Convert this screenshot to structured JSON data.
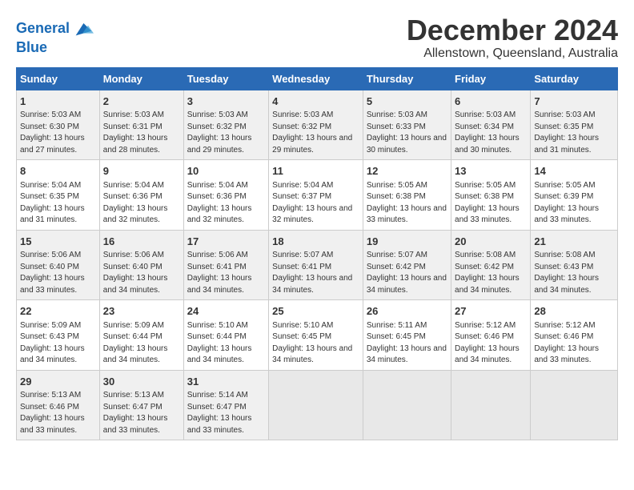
{
  "logo": {
    "line1": "General",
    "line2": "Blue"
  },
  "title": "December 2024",
  "subtitle": "Allenstown, Queensland, Australia",
  "weekdays": [
    "Sunday",
    "Monday",
    "Tuesday",
    "Wednesday",
    "Thursday",
    "Friday",
    "Saturday"
  ],
  "weeks": [
    [
      {
        "day": "1",
        "sunrise": "Sunrise: 5:03 AM",
        "sunset": "Sunset: 6:30 PM",
        "daylight": "Daylight: 13 hours and 27 minutes."
      },
      {
        "day": "2",
        "sunrise": "Sunrise: 5:03 AM",
        "sunset": "Sunset: 6:31 PM",
        "daylight": "Daylight: 13 hours and 28 minutes."
      },
      {
        "day": "3",
        "sunrise": "Sunrise: 5:03 AM",
        "sunset": "Sunset: 6:32 PM",
        "daylight": "Daylight: 13 hours and 29 minutes."
      },
      {
        "day": "4",
        "sunrise": "Sunrise: 5:03 AM",
        "sunset": "Sunset: 6:32 PM",
        "daylight": "Daylight: 13 hours and 29 minutes."
      },
      {
        "day": "5",
        "sunrise": "Sunrise: 5:03 AM",
        "sunset": "Sunset: 6:33 PM",
        "daylight": "Daylight: 13 hours and 30 minutes."
      },
      {
        "day": "6",
        "sunrise": "Sunrise: 5:03 AM",
        "sunset": "Sunset: 6:34 PM",
        "daylight": "Daylight: 13 hours and 30 minutes."
      },
      {
        "day": "7",
        "sunrise": "Sunrise: 5:03 AM",
        "sunset": "Sunset: 6:35 PM",
        "daylight": "Daylight: 13 hours and 31 minutes."
      }
    ],
    [
      {
        "day": "8",
        "sunrise": "Sunrise: 5:04 AM",
        "sunset": "Sunset: 6:35 PM",
        "daylight": "Daylight: 13 hours and 31 minutes."
      },
      {
        "day": "9",
        "sunrise": "Sunrise: 5:04 AM",
        "sunset": "Sunset: 6:36 PM",
        "daylight": "Daylight: 13 hours and 32 minutes."
      },
      {
        "day": "10",
        "sunrise": "Sunrise: 5:04 AM",
        "sunset": "Sunset: 6:36 PM",
        "daylight": "Daylight: 13 hours and 32 minutes."
      },
      {
        "day": "11",
        "sunrise": "Sunrise: 5:04 AM",
        "sunset": "Sunset: 6:37 PM",
        "daylight": "Daylight: 13 hours and 32 minutes."
      },
      {
        "day": "12",
        "sunrise": "Sunrise: 5:05 AM",
        "sunset": "Sunset: 6:38 PM",
        "daylight": "Daylight: 13 hours and 33 minutes."
      },
      {
        "day": "13",
        "sunrise": "Sunrise: 5:05 AM",
        "sunset": "Sunset: 6:38 PM",
        "daylight": "Daylight: 13 hours and 33 minutes."
      },
      {
        "day": "14",
        "sunrise": "Sunrise: 5:05 AM",
        "sunset": "Sunset: 6:39 PM",
        "daylight": "Daylight: 13 hours and 33 minutes."
      }
    ],
    [
      {
        "day": "15",
        "sunrise": "Sunrise: 5:06 AM",
        "sunset": "Sunset: 6:40 PM",
        "daylight": "Daylight: 13 hours and 33 minutes."
      },
      {
        "day": "16",
        "sunrise": "Sunrise: 5:06 AM",
        "sunset": "Sunset: 6:40 PM",
        "daylight": "Daylight: 13 hours and 34 minutes."
      },
      {
        "day": "17",
        "sunrise": "Sunrise: 5:06 AM",
        "sunset": "Sunset: 6:41 PM",
        "daylight": "Daylight: 13 hours and 34 minutes."
      },
      {
        "day": "18",
        "sunrise": "Sunrise: 5:07 AM",
        "sunset": "Sunset: 6:41 PM",
        "daylight": "Daylight: 13 hours and 34 minutes."
      },
      {
        "day": "19",
        "sunrise": "Sunrise: 5:07 AM",
        "sunset": "Sunset: 6:42 PM",
        "daylight": "Daylight: 13 hours and 34 minutes."
      },
      {
        "day": "20",
        "sunrise": "Sunrise: 5:08 AM",
        "sunset": "Sunset: 6:42 PM",
        "daylight": "Daylight: 13 hours and 34 minutes."
      },
      {
        "day": "21",
        "sunrise": "Sunrise: 5:08 AM",
        "sunset": "Sunset: 6:43 PM",
        "daylight": "Daylight: 13 hours and 34 minutes."
      }
    ],
    [
      {
        "day": "22",
        "sunrise": "Sunrise: 5:09 AM",
        "sunset": "Sunset: 6:43 PM",
        "daylight": "Daylight: 13 hours and 34 minutes."
      },
      {
        "day": "23",
        "sunrise": "Sunrise: 5:09 AM",
        "sunset": "Sunset: 6:44 PM",
        "daylight": "Daylight: 13 hours and 34 minutes."
      },
      {
        "day": "24",
        "sunrise": "Sunrise: 5:10 AM",
        "sunset": "Sunset: 6:44 PM",
        "daylight": "Daylight: 13 hours and 34 minutes."
      },
      {
        "day": "25",
        "sunrise": "Sunrise: 5:10 AM",
        "sunset": "Sunset: 6:45 PM",
        "daylight": "Daylight: 13 hours and 34 minutes."
      },
      {
        "day": "26",
        "sunrise": "Sunrise: 5:11 AM",
        "sunset": "Sunset: 6:45 PM",
        "daylight": "Daylight: 13 hours and 34 minutes."
      },
      {
        "day": "27",
        "sunrise": "Sunrise: 5:12 AM",
        "sunset": "Sunset: 6:46 PM",
        "daylight": "Daylight: 13 hours and 34 minutes."
      },
      {
        "day": "28",
        "sunrise": "Sunrise: 5:12 AM",
        "sunset": "Sunset: 6:46 PM",
        "daylight": "Daylight: 13 hours and 33 minutes."
      }
    ],
    [
      {
        "day": "29",
        "sunrise": "Sunrise: 5:13 AM",
        "sunset": "Sunset: 6:46 PM",
        "daylight": "Daylight: 13 hours and 33 minutes."
      },
      {
        "day": "30",
        "sunrise": "Sunrise: 5:13 AM",
        "sunset": "Sunset: 6:47 PM",
        "daylight": "Daylight: 13 hours and 33 minutes."
      },
      {
        "day": "31",
        "sunrise": "Sunrise: 5:14 AM",
        "sunset": "Sunset: 6:47 PM",
        "daylight": "Daylight: 13 hours and 33 minutes."
      },
      null,
      null,
      null,
      null
    ]
  ]
}
